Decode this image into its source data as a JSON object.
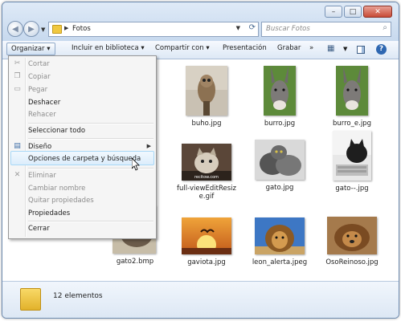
{
  "window": {
    "address": "Fotos",
    "search_placeholder": "Buscar Fotos",
    "controls": {
      "minimize": "–",
      "maximize": "□",
      "close": "✕"
    }
  },
  "toolbar": {
    "organizar": "Organizar ▾",
    "incluir": "Incluir en biblioteca ▾",
    "compartir": "Compartir con ▾",
    "presentacion": "Presentación",
    "grabar": "Grabar",
    "more": "»"
  },
  "menu": {
    "cortar": "Cortar",
    "copiar": "Copiar",
    "pegar": "Pegar",
    "deshacer": "Deshacer",
    "rehacer": "Rehacer",
    "seleccionar_todo": "Seleccionar todo",
    "diseno": "Diseño",
    "opciones": "Opciones de carpeta y búsqueda",
    "eliminar": "Eliminar",
    "cambiar_nombre": "Cambiar nombre",
    "quitar_propiedades": "Quitar propiedades",
    "propiedades": "Propiedades",
    "cerrar": "Cerrar"
  },
  "files": [
    {
      "name": "buho.jpg"
    },
    {
      "name": "burro.jpg"
    },
    {
      "name": "burro_e.jpg"
    },
    {
      "name": "full-viewEditResize.gif",
      "line1": "full-viewEditResiz",
      "line2": "e.gif",
      "watermark": "recitow.com"
    },
    {
      "name": "gato.jpg"
    },
    {
      "name": "gato--.jpg"
    },
    {
      "name": "gato2.bmp"
    },
    {
      "name": "gaviota.jpg"
    },
    {
      "name": "leon_alerta.jpeg"
    },
    {
      "name": "OsoReinoso.jpg"
    }
  ],
  "status": {
    "count": "12 elementos"
  }
}
